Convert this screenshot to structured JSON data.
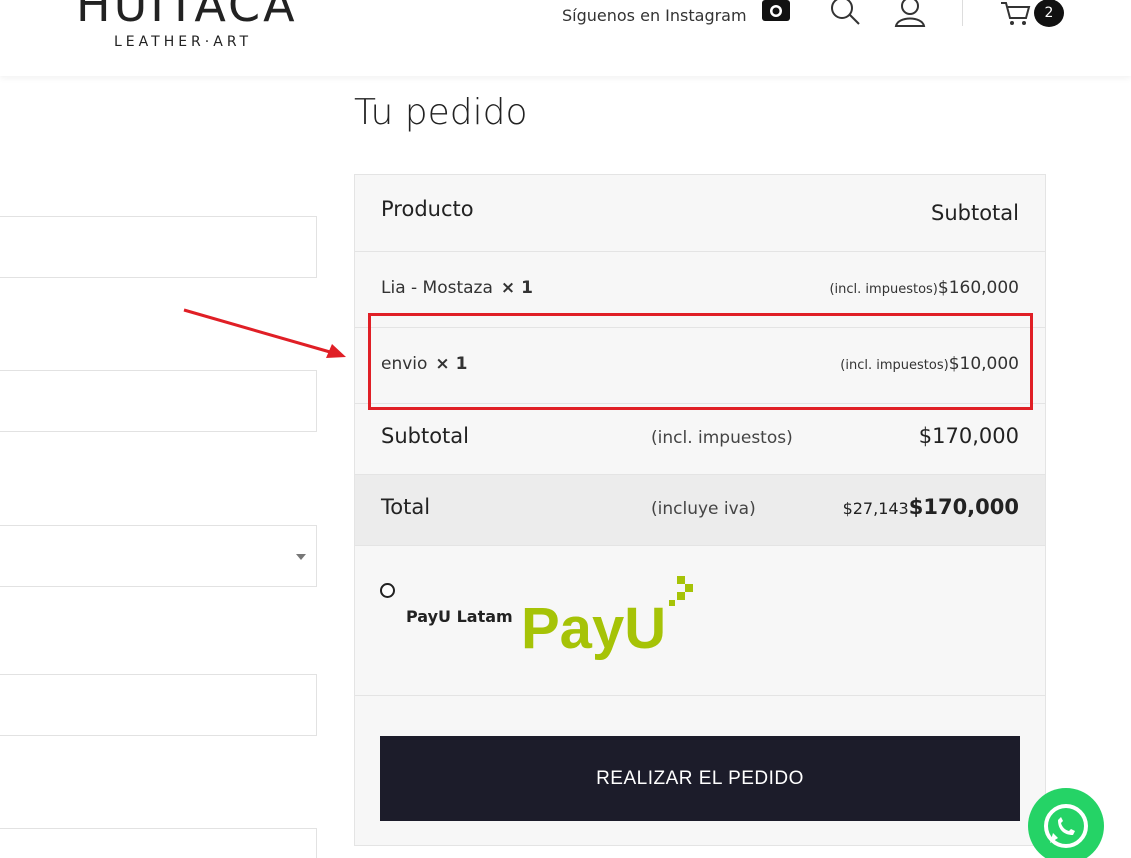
{
  "header": {
    "logo_main": "HUITACA",
    "logo_sub": "LEATHER·ART",
    "instagram_text": "Síguenos en Instagram",
    "cart_count": "2"
  },
  "order": {
    "title": "Tu pedido",
    "col_product": "Producto",
    "col_subtotal": "Subtotal",
    "items": [
      {
        "name": "Lia - Mostaza",
        "qty": "× 1",
        "tax_note": "(incl. impuestos)",
        "price": "$160,000"
      },
      {
        "name": "envio",
        "qty": "× 1",
        "tax_note": "(incl. impuestos)",
        "price": "$10,000"
      }
    ],
    "subtotal_label": "Subtotal",
    "subtotal_note": "(incl. impuestos)",
    "subtotal_value": "$170,000",
    "total_label": "Total",
    "total_note": "(incluye iva)",
    "total_tax": "$27,143",
    "total_value": "$170,000",
    "payment_method": "PayU Latam",
    "payment_logo_text": "PayU",
    "place_order": "REALIZAR EL PEDIDO"
  },
  "colors": {
    "accent_red": "#e01f26",
    "button_dark": "#1c1c2a",
    "payu_green": "#a6c307",
    "whatsapp_green": "#25d366"
  }
}
